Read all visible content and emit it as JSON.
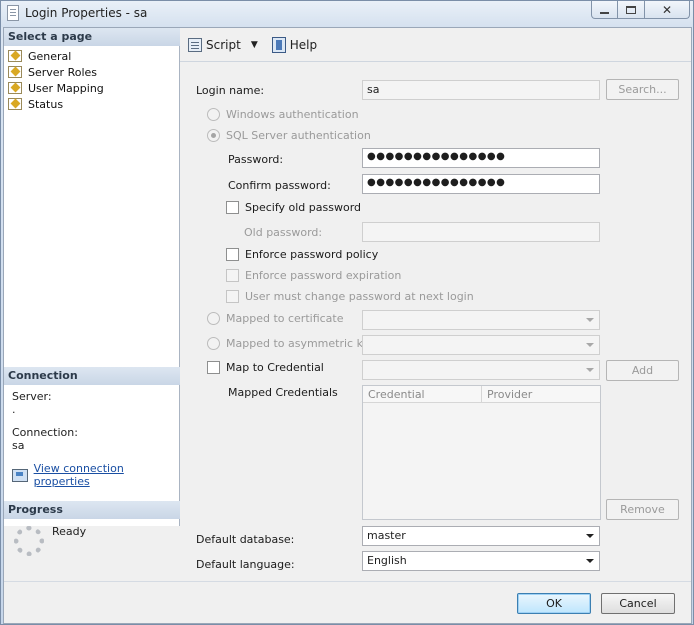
{
  "window": {
    "title": "Login Properties - sa",
    "controls": {
      "minimize_icon": "minimize-icon",
      "maximize_icon": "maximize-icon",
      "close_glyph": "✕"
    }
  },
  "left_pane": {
    "select_page_header": "Select a page",
    "pages": [
      {
        "label": "General",
        "icon": "page-icon"
      },
      {
        "label": "Server Roles",
        "icon": "page-icon"
      },
      {
        "label": "User Mapping",
        "icon": "page-icon"
      },
      {
        "label": "Status",
        "icon": "page-icon"
      }
    ],
    "connection_header": "Connection",
    "connection": {
      "server_label": "Server:",
      "server_value": ".",
      "connection_label": "Connection:",
      "connection_value": "sa",
      "view_link": "View connection properties"
    },
    "progress_header": "Progress",
    "progress_status": "Ready"
  },
  "toolbar": {
    "script_label": "Script",
    "help_label": "Help"
  },
  "form": {
    "login_name_label": "Login name:",
    "login_name_value": "sa",
    "search_button": "Search...",
    "windows_auth_label": "Windows authentication",
    "sql_auth_label": "SQL Server authentication",
    "password_label": "Password:",
    "password_value": "●●●●●●●●●●●●●●●",
    "confirm_password_label": "Confirm password:",
    "confirm_password_value": "●●●●●●●●●●●●●●●",
    "specify_old_password_label": "Specify old password",
    "old_password_label": "Old password:",
    "enforce_policy_label": "Enforce password policy",
    "enforce_expiration_label": "Enforce password expiration",
    "must_change_label": "User must change password at next login",
    "mapped_certificate_label": "Mapped to certificate",
    "mapped_asym_key_label": "Mapped to asymmetric key",
    "map_credential_label": "Map to Credential",
    "add_button": "Add",
    "mapped_credentials_label": "Mapped Credentials",
    "credentials_columns": [
      "Credential",
      "Provider"
    ],
    "remove_button": "Remove",
    "default_database_label": "Default database:",
    "default_database_value": "master",
    "default_language_label": "Default language:",
    "default_language_value": "English"
  },
  "footer": {
    "ok_button": "OK",
    "cancel_button": "Cancel"
  }
}
